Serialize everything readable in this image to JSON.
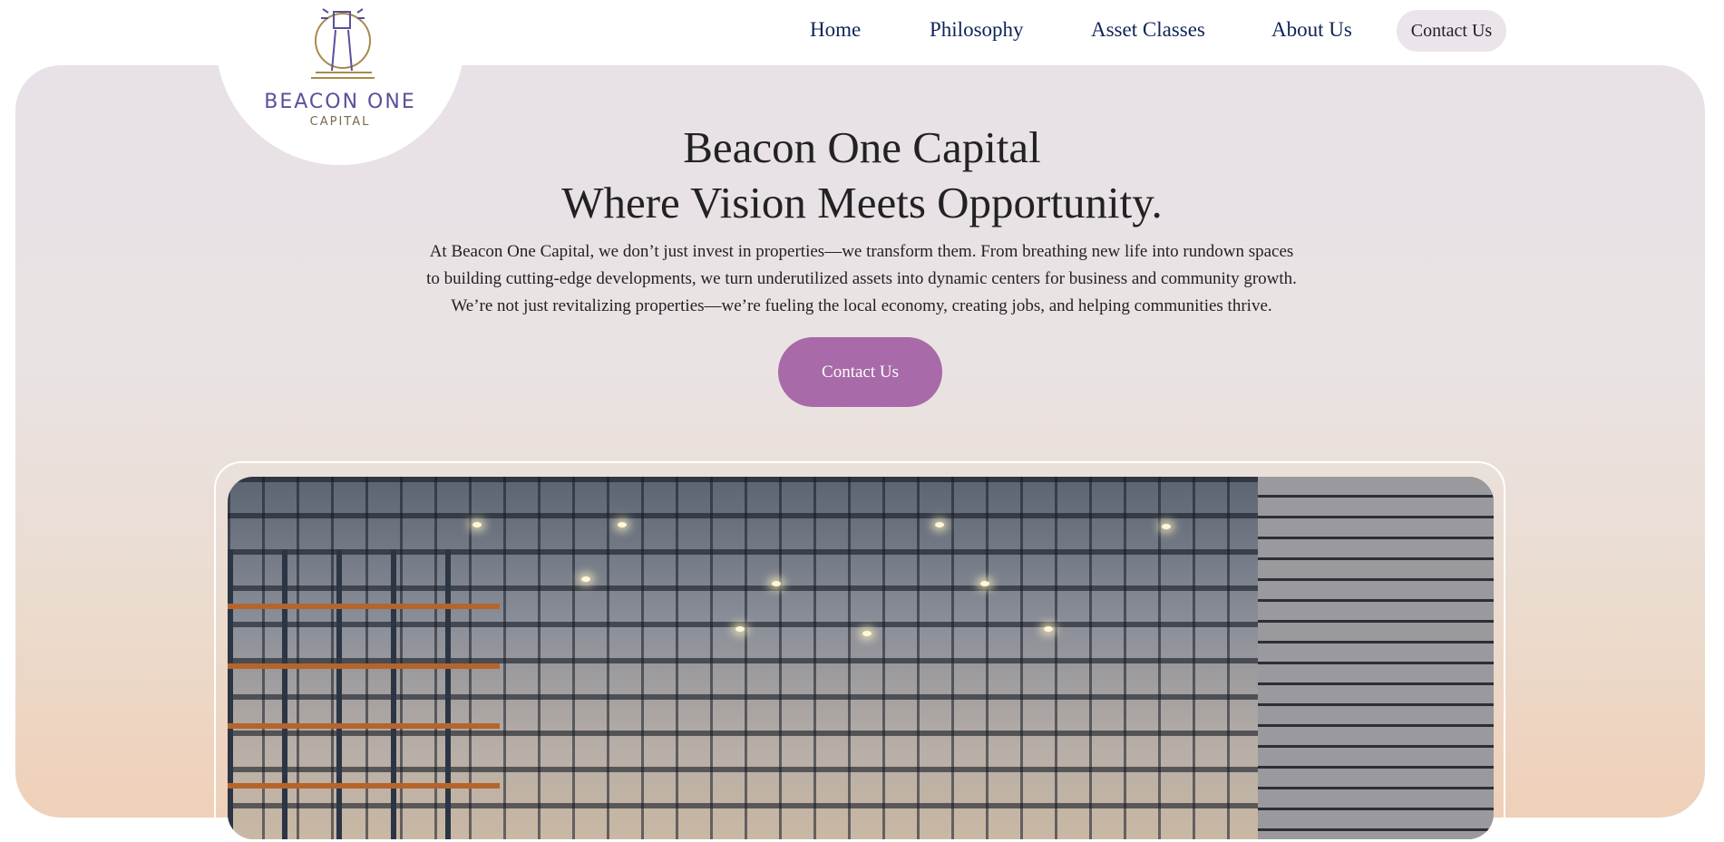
{
  "logo": {
    "name": "BEACON ONE",
    "sub": "CAPITAL"
  },
  "nav": {
    "items": [
      "Home",
      "Philosophy",
      "Asset Classes",
      "About Us"
    ],
    "contact": "Contact Us"
  },
  "hero": {
    "title_line1": "Beacon One Capital",
    "title_line2": "Where Vision Meets Opportunity.",
    "para_line1": "At Beacon One Capital, we don’t just invest in properties—we transform them. From breathing new life into rundown spaces",
    "para_line2": "to building cutting-edge developments, we turn underutilized assets into dynamic centers for business and community growth.",
    "para_line3": "We’re not just revitalizing properties—we’re fueling the local economy, creating jobs, and helping communities thrive.",
    "cta": "Contact Us"
  },
  "colors": {
    "accent": "#a86aa8",
    "nav_text": "#0e2457",
    "logo_purple": "#5b4f9d",
    "logo_gold": "#a88a4a"
  }
}
